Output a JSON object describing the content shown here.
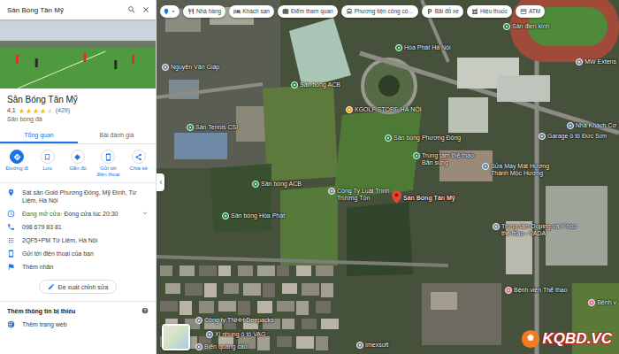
{
  "search": {
    "query": "Sân Bóng Tân Mỹ"
  },
  "place": {
    "title": "Sân Bóng Tân Mỹ",
    "rating": "4,1",
    "stars": 4,
    "reviews": "(429)",
    "category": "Sân bóng đá"
  },
  "tabs": [
    {
      "label": "Tổng quan",
      "selected": true
    },
    {
      "label": "Bài đánh giá",
      "selected": false
    }
  ],
  "actions": [
    {
      "label": "Đường đi",
      "primary": true
    },
    {
      "label": "Lưu",
      "primary": false
    },
    {
      "label": "Gần đó",
      "primary": false
    },
    {
      "label": "Gửi tới điện thoại",
      "primary": false
    },
    {
      "label": "Chia sẻ",
      "primary": false
    }
  ],
  "info": [
    {
      "kind": "address",
      "status": "",
      "text": "Sát sân Gold Phương Đông, Mỹ Đình, Từ Liêm, Hà Nội",
      "expandable": false
    },
    {
      "kind": "hours",
      "status": "Đang mở cửa",
      "text": "· Đóng cửa lúc 20:30",
      "expandable": true
    },
    {
      "kind": "phone",
      "status": "",
      "text": "098 679 83 81",
      "expandable": false
    },
    {
      "kind": "pluscode",
      "status": "",
      "text": "2QF5+PM Từ Liêm, Hà Nội",
      "expandable": false
    },
    {
      "kind": "send",
      "status": "",
      "text": "Gửi tới điện thoại của bạn",
      "expandable": false
    },
    {
      "kind": "label",
      "status": "",
      "text": "Thêm nhãn",
      "expandable": false
    }
  ],
  "suggest_edit": "Đề xuất chỉnh sửa",
  "missing": {
    "title": "Thêm thông tin bị thiếu",
    "items": [
      "Thêm trang web"
    ]
  },
  "map": {
    "chips": [
      "Nhà hàng",
      "Khách sạn",
      "Điểm tham quan",
      "Phương tiện công cộ…",
      "Bãi đỗ xe",
      "Hiệu thuốc",
      "ATM"
    ],
    "places": [
      {
        "name": "Sân điền kinh",
        "color": "#1e8e3e",
        "selected": false
      },
      {
        "name": "Hòa Phát Hà Nội",
        "color": "#1e8e3e",
        "selected": false
      },
      {
        "name": "MW Extens",
        "color": "#7b8794",
        "selected": false
      },
      {
        "name": "Nguyễn Văn Giáp",
        "color": "#7b8794",
        "selected": false
      },
      {
        "name": "Sân bóng ACB",
        "color": "#1e8e3e",
        "selected": false
      },
      {
        "name": "KGOLF STORE HÀ NỘI",
        "color": "#f29900",
        "selected": false
      },
      {
        "name": "Sân Tennis CSI",
        "color": "#1e8e3e",
        "selected": false
      },
      {
        "name": "Sân bóng Phương Đông",
        "color": "#1e8e3e",
        "selected": false
      },
      {
        "name": "Garage ô tô Đức Sơn",
        "color": "#5b7fa6",
        "selected": false
      },
      {
        "name": "Nhà Khách Cơ",
        "color": "#5b7fa6",
        "selected": false
      },
      {
        "name": "Trung tâm thể thao Bắn súng",
        "color": "#1e8e3e",
        "selected": false
      },
      {
        "name": "Sửa Máy Mát Hương Thành Mộc Hương",
        "color": "#5b7fa6",
        "selected": false
      },
      {
        "name": "Sân bóng ACB",
        "color": "#1e8e3e",
        "selected": false
      },
      {
        "name": "Công Ty Luật Trình Trương Tôn",
        "color": "#7b8794",
        "selected": false
      },
      {
        "name": "Sân Bóng Tân Mỹ",
        "color": "#ea4335",
        "selected": true
      },
      {
        "name": "Sân bóng Hòa Phát",
        "color": "#1e8e3e",
        "selected": false
      },
      {
        "name": "Trung tâm Doping và Y học thể thao - VADA",
        "color": "#7b8794",
        "selected": false
      },
      {
        "name": "Bệnh viện Thể thao",
        "color": "#e8618c",
        "selected": false
      },
      {
        "name": "Bệnh v",
        "color": "#e8618c",
        "selected": false
      },
      {
        "name": "Công ty TNHH Deepacks",
        "color": "#7b8794",
        "selected": false
      },
      {
        "name": "Xi nhung ô tô VAG",
        "color": "#5b7fa6",
        "selected": false
      },
      {
        "name": "Biển quảng cáo",
        "color": "#7b8794",
        "selected": false
      },
      {
        "name": "Imexsoft",
        "color": "#7b8794",
        "selected": false
      }
    ]
  },
  "watermark": "KQBD.VC"
}
